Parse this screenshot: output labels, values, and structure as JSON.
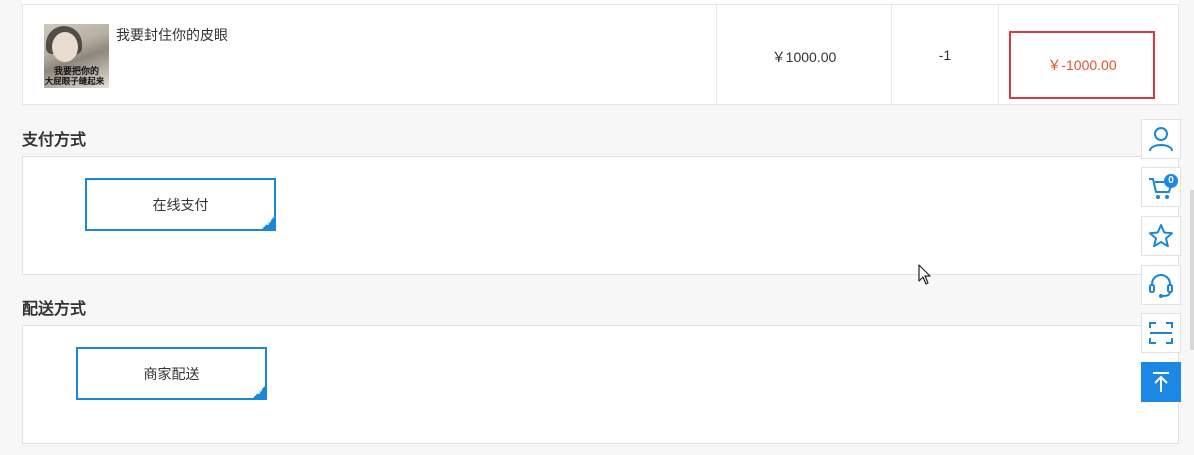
{
  "order_item": {
    "product_name": "我要封住你的皮眼",
    "image_caption_1": "我要把你的",
    "image_caption_2": "大屁眼子缝起来",
    "unit_price": "￥1000.00",
    "quantity": "-1",
    "subtotal": "￥-1000.00"
  },
  "payment": {
    "title": "支付方式",
    "options": [
      {
        "label": "在线支付",
        "selected": true
      }
    ]
  },
  "delivery": {
    "title": "配送方式",
    "options": [
      {
        "label": "商家配送",
        "selected": true
      }
    ]
  },
  "sidebar": {
    "items": [
      {
        "icon": "user-icon"
      },
      {
        "icon": "cart-icon",
        "badge": "0"
      },
      {
        "icon": "star-icon"
      },
      {
        "icon": "headset-icon"
      },
      {
        "icon": "scan-icon"
      },
      {
        "icon": "back-to-top-icon"
      }
    ]
  },
  "colors": {
    "accent": "#1a86d6",
    "price_red": "#e4532a",
    "highlight_border": "#e0363d"
  }
}
